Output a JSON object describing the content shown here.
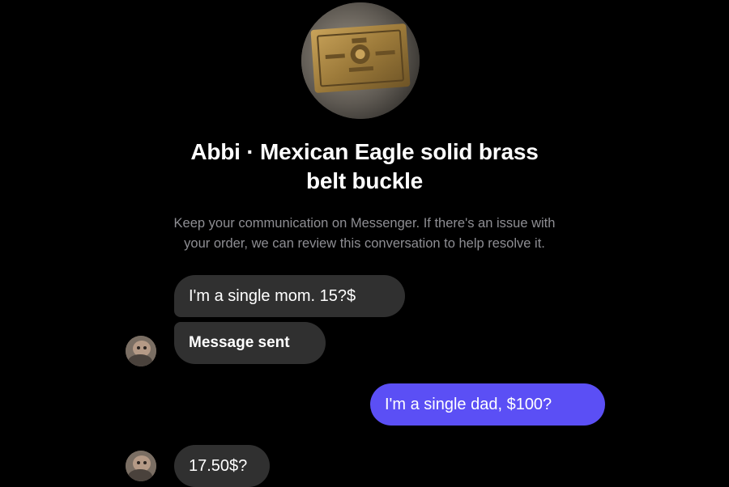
{
  "header": {
    "photo_icon": "belt-buckle-photo",
    "title_line1": "Abbi · Mexican Eagle solid brass",
    "title_line2": "belt buckle",
    "notice_line1": "Keep your communication on Messenger. If there's an issue with",
    "notice_line2": "your order, we can review this conversation to help resolve it."
  },
  "messages": [
    {
      "sender": "incoming",
      "text": "I'm a single mom. 15?$"
    },
    {
      "sender": "incoming",
      "text": "Message sent"
    },
    {
      "sender": "outgoing",
      "text": "I'm a single dad, $100?"
    },
    {
      "sender": "incoming",
      "text": "17.50$?"
    }
  ],
  "colors": {
    "background": "#000000",
    "incoming_bubble": "#303030",
    "outgoing_bubble": "#5b4ff5",
    "notice_text": "#8e8e93"
  }
}
